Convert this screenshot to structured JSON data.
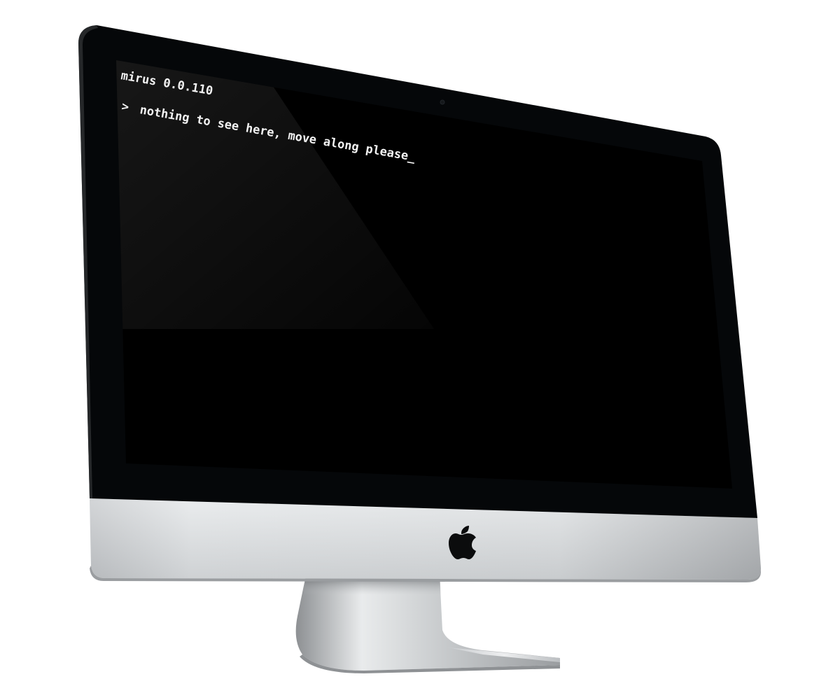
{
  "terminal": {
    "version_line": "mirus 0.0.110",
    "prompt_symbol": ">",
    "command_text": "nothing to see here, move along please",
    "cursor": "_"
  },
  "device": {
    "logo_icon": "apple-logo-icon"
  },
  "colors": {
    "screen_background": "#000000",
    "bezel": "#050709",
    "text": "#f2f2f2",
    "chin": "#dfe2e4",
    "stand": "#b5b8bb"
  }
}
